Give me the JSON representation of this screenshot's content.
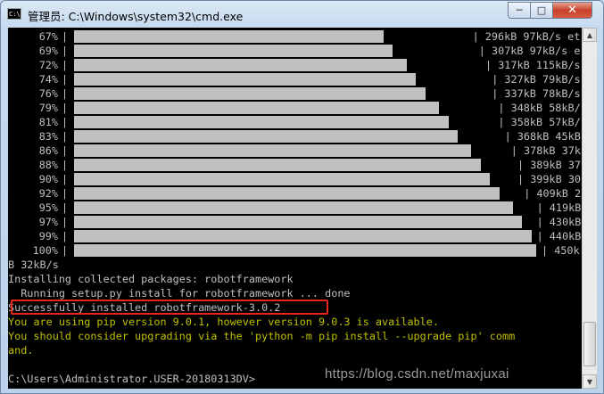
{
  "window": {
    "title": "管理员: C:\\Windows\\system32\\cmd.exe",
    "icon": "cmd-icon",
    "controls": {
      "minimize": "─",
      "maximize": "□",
      "close": "✕"
    }
  },
  "progress_rows": [
    {
      "pct": "67%",
      "fill": 0.67,
      "right": "| 296kB 97kB/s et"
    },
    {
      "pct": "69%",
      "fill": 0.69,
      "right": "| 307kB 97kB/s e"
    },
    {
      "pct": "72%",
      "fill": 0.72,
      "right": "| 317kB 115kB/s"
    },
    {
      "pct": "74%",
      "fill": 0.74,
      "right": "| 327kB 79kB/s"
    },
    {
      "pct": "76%",
      "fill": 0.76,
      "right": "| 337kB 78kB/s"
    },
    {
      "pct": "79%",
      "fill": 0.79,
      "right": "| 348kB 58kB/"
    },
    {
      "pct": "81%",
      "fill": 0.81,
      "right": "| 358kB 57kB/"
    },
    {
      "pct": "83%",
      "fill": 0.83,
      "right": "| 368kB 45kB"
    },
    {
      "pct": "86%",
      "fill": 0.86,
      "right": "| 378kB 37k"
    },
    {
      "pct": "88%",
      "fill": 0.88,
      "right": "| 389kB 37"
    },
    {
      "pct": "90%",
      "fill": 0.9,
      "right": "| 399kB 30"
    },
    {
      "pct": "92%",
      "fill": 0.92,
      "right": "| 409kB 2"
    },
    {
      "pct": "95%",
      "fill": 0.95,
      "right": "| 419kB"
    },
    {
      "pct": "97%",
      "fill": 0.97,
      "right": "| 430kB"
    },
    {
      "pct": "99%",
      "fill": 0.99,
      "right": "| 440kB"
    },
    {
      "pct": "100%",
      "fill": 1.0,
      "right": "| 450k"
    }
  ],
  "output_lines": [
    {
      "text": "B 32kB/s",
      "color": "gray"
    },
    {
      "text": "Installing collected packages: robotframework",
      "color": "gray"
    },
    {
      "text": "  Running setup.py install for robotframework ... done",
      "color": "gray"
    },
    {
      "text": "Successfully installed robotframework-3.0.2",
      "color": "gray"
    },
    {
      "text": "You are using pip version 9.0.1, however version 9.0.3 is available.",
      "color": "yellow"
    },
    {
      "text": "You should consider upgrading via the 'python -m pip install --upgrade pip' comm",
      "color": "yellow"
    },
    {
      "text": "and.",
      "color": "yellow"
    },
    {
      "text": "",
      "color": "gray"
    },
    {
      "text": "C:\\Users\\Administrator.USER-20180313DV>",
      "color": "gray"
    }
  ],
  "watermark": "https://blog.csdn.net/maxjuxai",
  "colors": {
    "console_bg": "#000000",
    "console_text": "#c0c0c0",
    "warning_text": "#c0c000",
    "highlight_border": "#e8241b"
  }
}
